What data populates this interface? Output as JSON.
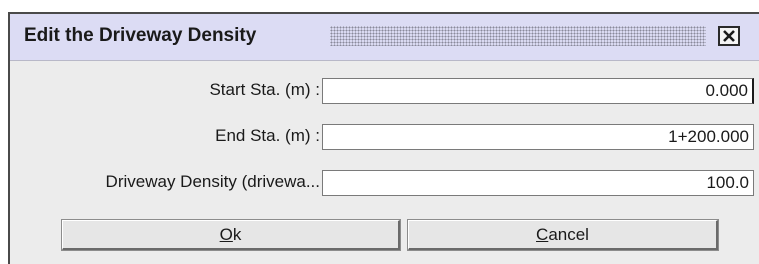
{
  "dialog": {
    "title": "Edit the Driveway Density",
    "close_icon": "close-icon"
  },
  "fields": [
    {
      "label": "Start Sta. (m) :",
      "value": "0.000"
    },
    {
      "label": "End Sta. (m) :",
      "value": "1+200.000"
    },
    {
      "label": "Driveway Density (drivewa...",
      "value": "100.0"
    }
  ],
  "buttons": {
    "ok": {
      "mnemonic": "O",
      "rest": "k"
    },
    "cancel": {
      "mnemonic": "C",
      "rest": "ancel"
    }
  }
}
